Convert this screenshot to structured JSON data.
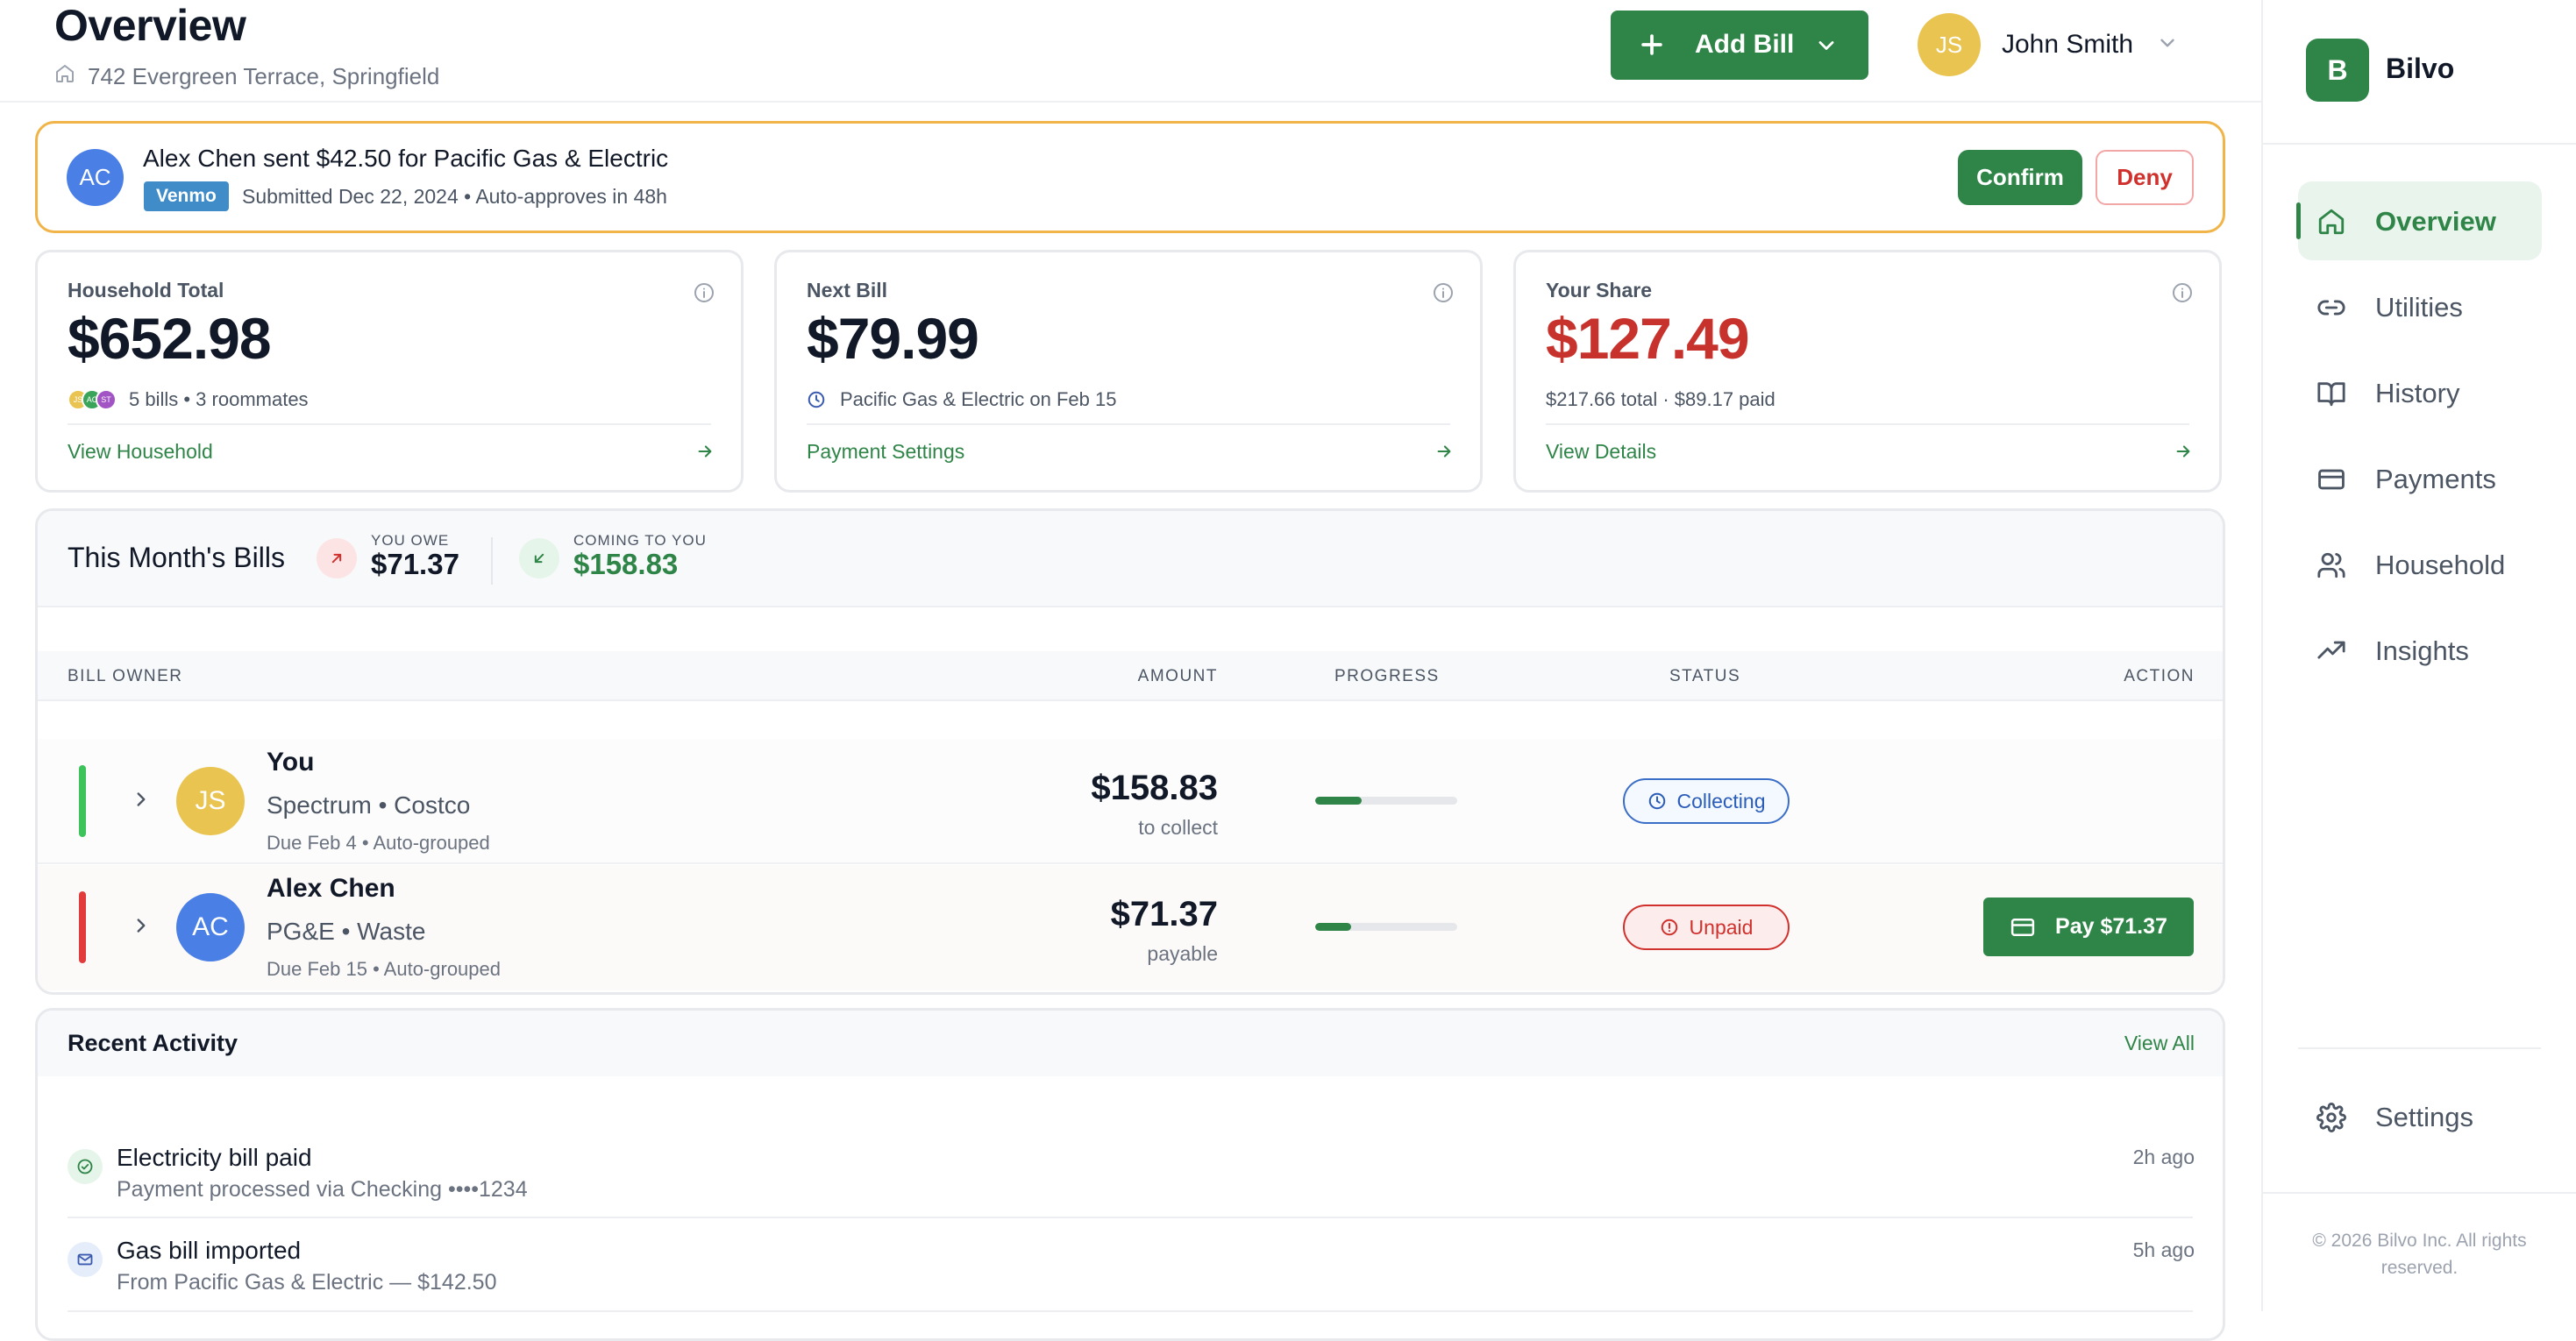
{
  "header": {
    "title": "Overview",
    "address": "742 Evergreen Terrace, Springfield",
    "add_bill_label": "Add Bill",
    "user_initials": "JS",
    "user_name": "John Smith"
  },
  "banner": {
    "avatar_initials": "AC",
    "title": "Alex Chen sent $42.50 for Pacific Gas & Electric",
    "method": "Venmo",
    "submitted": "Submitted Dec 22, 2024 • Auto-approves in 48h",
    "confirm_label": "Confirm",
    "deny_label": "Deny"
  },
  "cards": {
    "household": {
      "label": "Household Total",
      "value": "$652.98",
      "meta": "5 bills • 3 roommates",
      "mini_avatars": [
        "JS",
        "AC",
        "ST"
      ],
      "link": "View Household"
    },
    "next_bill": {
      "label": "Next Bill",
      "value": "$79.99",
      "meta": "Pacific Gas & Electric on Feb 15",
      "link": "Payment Settings"
    },
    "your_share": {
      "label": "Your Share",
      "value": "$127.49",
      "meta": "$217.66 total · $89.17 paid",
      "link": "View Details"
    }
  },
  "bills": {
    "title": "This Month's Bills",
    "you_owe_label": "YOU OWE",
    "you_owe_value": "$71.37",
    "coming_label": "COMING TO YOU",
    "coming_value": "$158.83",
    "columns": {
      "owner": "BILL OWNER",
      "amount": "AMOUNT",
      "progress": "PROGRESS",
      "status": "STATUS",
      "action": "ACTION"
    },
    "rows": [
      {
        "initials": "JS",
        "name": "You",
        "vendors": "Spectrum • Costco",
        "due": "Due Feb 4 • Auto-grouped",
        "amount": "$158.83",
        "amount_sub": "to collect",
        "progress": 0.33,
        "status": "Collecting",
        "status_color": "#2a5db8",
        "bar_color": "#3cc45a",
        "action": ""
      },
      {
        "initials": "AC",
        "name": "Alex Chen",
        "vendors": "PG&E • Waste",
        "due": "Due Feb 15 • Auto-grouped",
        "amount": "$71.37",
        "amount_sub": "payable",
        "progress": 0.25,
        "status": "Unpaid",
        "status_color": "#d0312d",
        "bar_color": "#e23b3b",
        "action": "Pay $71.37"
      }
    ]
  },
  "activity": {
    "title": "Recent Activity",
    "view_all": "View All",
    "items": [
      {
        "icon": "check-circle-icon",
        "title": "Electricity bill paid",
        "subtitle": "Payment processed via Checking ••••1234",
        "time": "2h ago"
      },
      {
        "icon": "mail-icon",
        "title": "Gas bill imported",
        "subtitle": "From Pacific Gas & Electric — $142.50",
        "time": "5h ago"
      }
    ]
  },
  "sidebar": {
    "logo_letter": "B",
    "brand": "Bilvo",
    "items": [
      {
        "label": "Overview",
        "icon": "home-icon",
        "active": true
      },
      {
        "label": "Utilities",
        "icon": "link-icon",
        "active": false
      },
      {
        "label": "History",
        "icon": "book-icon",
        "active": false
      },
      {
        "label": "Payments",
        "icon": "credit-card-icon",
        "active": false
      },
      {
        "label": "Household",
        "icon": "users-icon",
        "active": false
      },
      {
        "label": "Insights",
        "icon": "trending-up-icon",
        "active": false
      }
    ],
    "settings_label": "Settings",
    "copyright": "© 2026 Bilvo Inc. All rights reserved."
  },
  "colors": {
    "accent": "#2f8548",
    "danger": "#c8322c",
    "banner_border": "#f0b449",
    "info_blue": "#3f8cc9"
  }
}
